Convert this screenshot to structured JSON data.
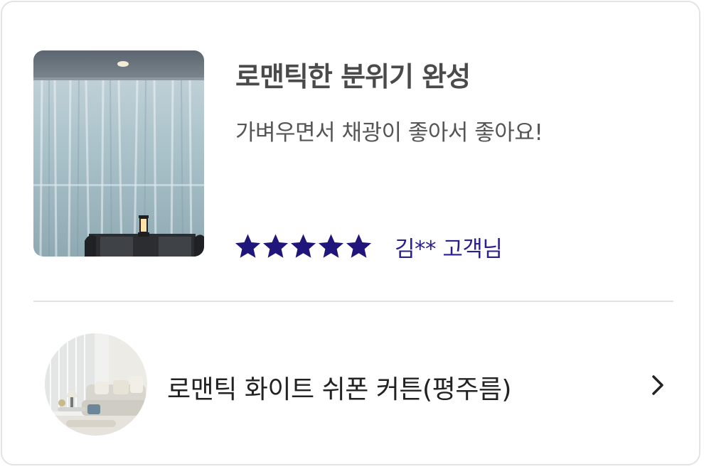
{
  "review": {
    "title": "로맨틱한 분위기 완성",
    "body": "가벼우면서 채광이 좋아서 좋아요!",
    "rating": 5,
    "rating_max": 5,
    "reviewer": "김** 고객님",
    "accent_color": "#1f157a"
  },
  "product": {
    "name": "로맨틱 화이트 쉬폰 커튼(평주름)",
    "link_icon": "chevron-right-icon"
  }
}
